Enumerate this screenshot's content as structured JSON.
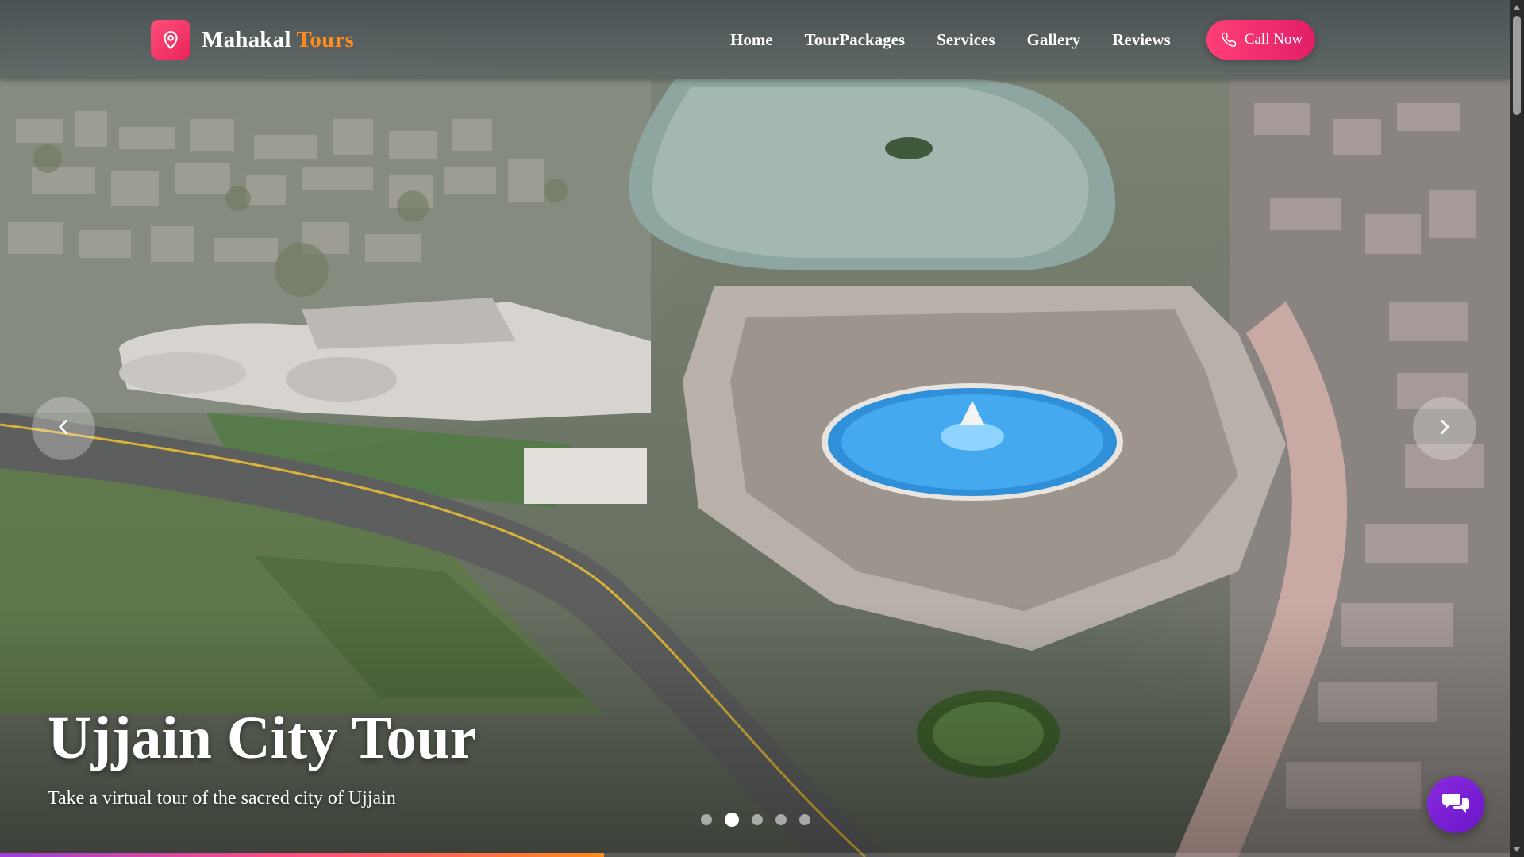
{
  "brand": {
    "name_main": "Mahakal",
    "name_accent": "Tours",
    "logo_icon": "map-pin-icon",
    "accent_color": "#ff8a1e",
    "badge_color": "#ff4f7a"
  },
  "nav": {
    "items": [
      {
        "label": "Home"
      },
      {
        "label": "TourPackages"
      },
      {
        "label": "Services"
      },
      {
        "label": "Gallery"
      },
      {
        "label": "Reviews"
      }
    ],
    "call_label": "Call Now",
    "call_icon": "phone-icon",
    "call_color": "#ff3f77"
  },
  "slider": {
    "title": "Ujjain City Tour",
    "subtitle": "Take a virtual tour of the sacred city of Ujjain",
    "prev_icon": "chevron-left-icon",
    "next_icon": "chevron-right-icon",
    "dot_count": 5,
    "active_dot": 2,
    "progress_fraction": 0.4
  },
  "chat": {
    "icon": "chat-bubbles-icon",
    "color": "#7b1fd6"
  }
}
